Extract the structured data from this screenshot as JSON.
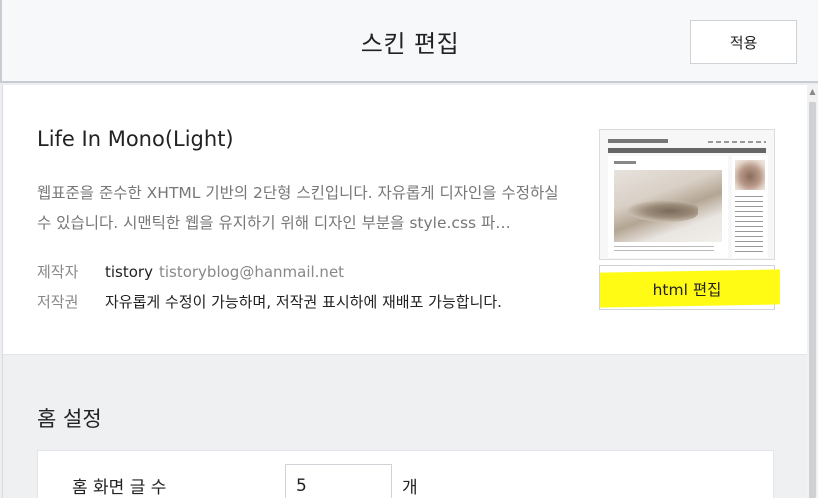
{
  "header": {
    "title": "스킨 편집",
    "apply_label": "적용"
  },
  "skin": {
    "name": "Life In Mono(Light)",
    "description": "웹표준을 준수한 XHTML 기반의 2단형 스킨입니다. 자유롭게 디자인을 수정하실 수 있습니다. 시맨틱한 웹을 유지하기 위해 디자인 부분을 style.css 파…",
    "author_label": "제작자",
    "author_name": "tistory",
    "author_email": "tistoryblog@hanmail.net",
    "copyright_label": "저작권",
    "copyright_text": "자유롭게 수정이 가능하며, 저작권 표시하에 재배포 가능합니다.",
    "thumbnail_title": "Life In Mono(Light)",
    "html_edit_label": "html 편집",
    "highlight_color": "#fffb14"
  },
  "home_settings": {
    "title": "홈 설정",
    "post_count_label": "홈 화면 글 수",
    "post_count_value": "5",
    "post_count_unit": "개"
  }
}
